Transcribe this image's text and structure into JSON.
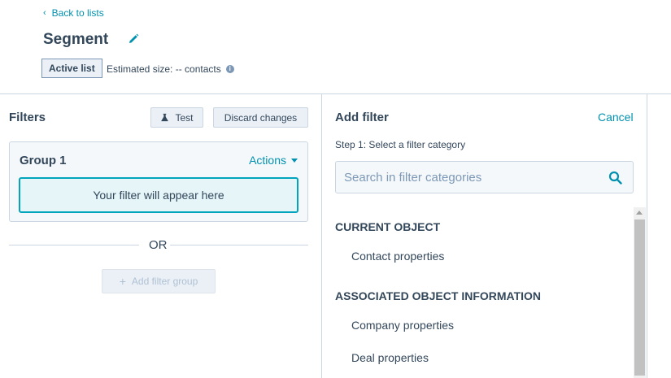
{
  "header": {
    "back_label": "Back to lists",
    "title": "Segment",
    "badge": "Active list",
    "estimated_size": "Estimated size: -- contacts"
  },
  "filters_panel": {
    "title": "Filters",
    "test_label": "Test",
    "discard_label": "Discard changes",
    "group": {
      "title": "Group 1",
      "actions_label": "Actions",
      "placeholder": "Your filter will appear here"
    },
    "or_label": "OR",
    "add_group_label": "Add filter group"
  },
  "add_filter_panel": {
    "title": "Add filter",
    "cancel_label": "Cancel",
    "step_label": "Step 1: Select a filter category",
    "search_placeholder": "Search in filter categories",
    "sections": [
      {
        "header": "CURRENT OBJECT",
        "items": [
          "Contact properties"
        ]
      },
      {
        "header": "ASSOCIATED OBJECT INFORMATION",
        "items": [
          "Company properties",
          "Deal properties"
        ]
      }
    ]
  },
  "colors": {
    "accent": "#0091ae",
    "text": "#33475b",
    "border": "#cbd6e2",
    "placeholder_border": "#00a4bd"
  },
  "icons": [
    "chevron-left-icon",
    "pencil-icon",
    "info-icon",
    "flask-icon",
    "chevron-down-icon",
    "plus-icon",
    "search-icon"
  ]
}
